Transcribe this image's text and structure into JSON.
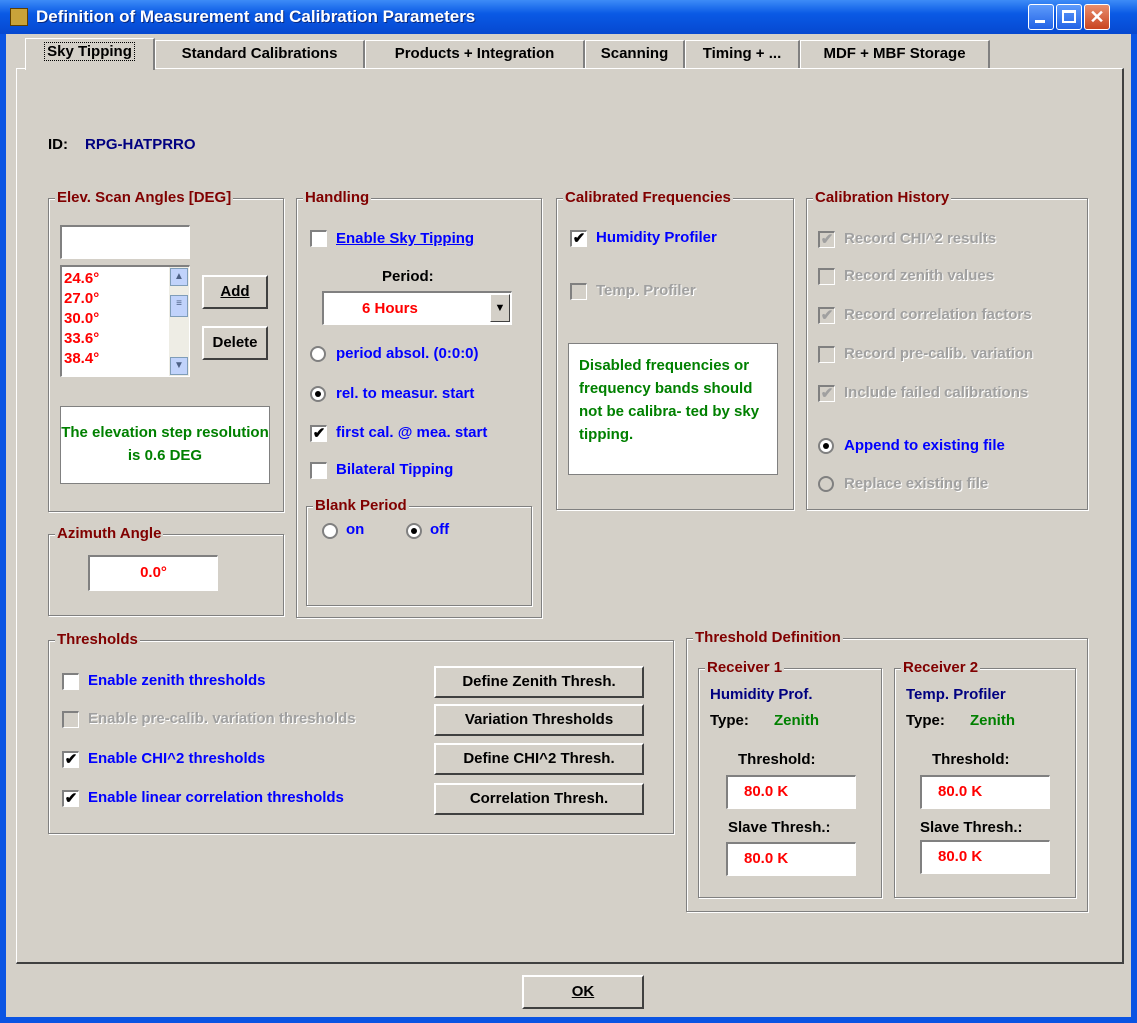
{
  "window": {
    "title": "Definition of Measurement and Calibration Parameters"
  },
  "tabs": [
    {
      "label": "Sky Tipping"
    },
    {
      "label": "Standard Calibrations"
    },
    {
      "label": "Products + Integration"
    },
    {
      "label": "Scanning"
    },
    {
      "label": "Timing + ..."
    },
    {
      "label": "MDF + MBF Storage"
    }
  ],
  "id": {
    "label": "ID:",
    "value": "RPG-HATPRRO"
  },
  "elev": {
    "title": "Elev. Scan Angles [DEG]",
    "input_value": "",
    "items": [
      "24.6°",
      "27.0°",
      "30.0°",
      "33.6°",
      "38.4°"
    ],
    "add_label": "Add",
    "delete_label": "Delete",
    "note": "The elevation step resolution is 0.6 DEG"
  },
  "azimuth": {
    "title": "Azimuth Angle",
    "value": "0.0°"
  },
  "handling": {
    "title": "Handling",
    "enable_sky_tipping": {
      "label": "Enable Sky Tipping",
      "checked": false
    },
    "period_label": "Period:",
    "period_value": "6 Hours",
    "radio_absol": {
      "label": "period absol. (0:0:0)",
      "selected": false
    },
    "radio_rel": {
      "label": "rel. to measur. start",
      "selected": true
    },
    "first_cal": {
      "label": "first cal. @ mea. start",
      "checked": true
    },
    "bilateral": {
      "label": "Bilateral Tipping",
      "checked": false
    },
    "blank_period": {
      "title": "Blank Period",
      "on": "on",
      "off": "off",
      "selected": "off"
    }
  },
  "calfreq": {
    "title": "Calibrated Frequencies",
    "humidity": {
      "label": "Humidity Profiler",
      "checked": true
    },
    "temp": {
      "label": "Temp. Profiler",
      "checked": false
    },
    "note": "Disabled frequencies or frequency bands should not be calibra- ted by sky tipping."
  },
  "calhist": {
    "title": "Calibration History",
    "items": [
      {
        "label": "Record CHI^2 results",
        "checked": true
      },
      {
        "label": "Record zenith values",
        "checked": false
      },
      {
        "label": "Record correlation factors",
        "checked": true
      },
      {
        "label": "Record pre-calib. variation",
        "checked": false
      },
      {
        "label": "Include failed calibrations",
        "checked": true
      }
    ],
    "append": {
      "label": "Append to existing file",
      "selected": true
    },
    "replace": {
      "label": "Replace existing file",
      "selected": false
    }
  },
  "thresholds": {
    "title": "Thresholds",
    "rows": [
      {
        "label": "Enable zenith thresholds",
        "checked": false,
        "button": "Define Zenith Thresh."
      },
      {
        "label": "Enable pre-calib. variation thresholds",
        "checked": false,
        "button": "Variation Thresholds"
      },
      {
        "label": "Enable CHI^2 thresholds",
        "checked": true,
        "button": "Define CHI^2 Thresh."
      },
      {
        "label": "Enable linear correlation thresholds",
        "checked": true,
        "button": "Correlation Thresh."
      }
    ]
  },
  "thresh_def": {
    "title": "Threshold Definition",
    "receivers": [
      {
        "title": "Receiver 1",
        "name": "Humidity Prof.",
        "type_label": "Type:",
        "type_value": "Zenith",
        "threshold_label": "Threshold:",
        "threshold": "80.0 K",
        "slave_label": "Slave Thresh.:",
        "slave": "80.0 K"
      },
      {
        "title": "Receiver 2",
        "name": "Temp. Profiler",
        "type_label": "Type:",
        "type_value": "Zenith",
        "threshold_label": "Threshold:",
        "threshold": "80.0 K",
        "slave_label": "Slave Thresh.:",
        "slave": "80.0 K"
      }
    ]
  },
  "ok_label": "OK"
}
